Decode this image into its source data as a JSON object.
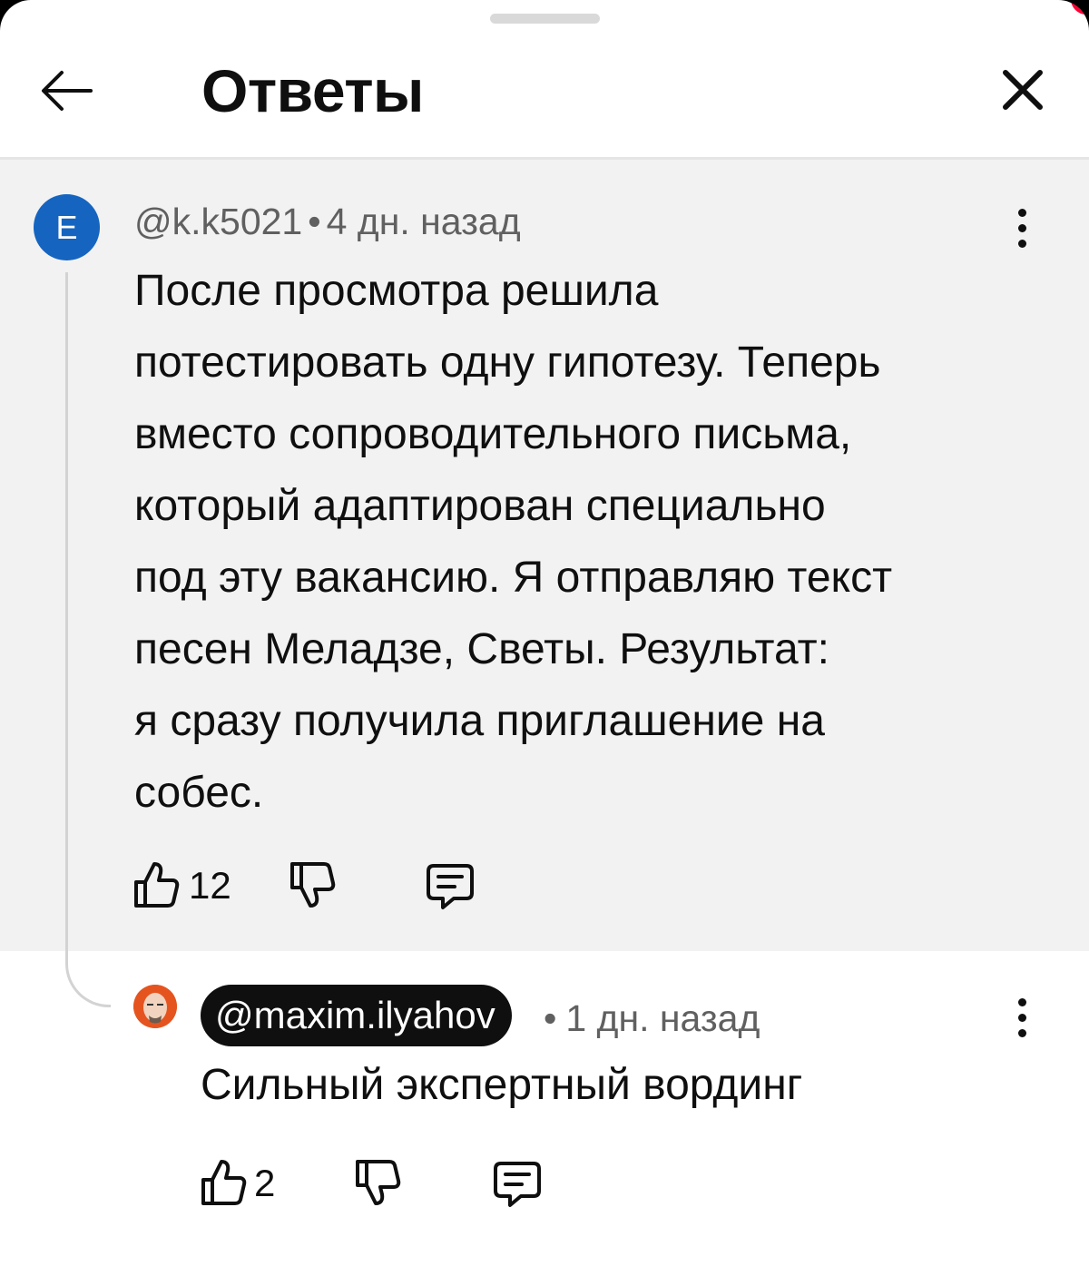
{
  "header": {
    "title": "Ответы",
    "back_icon": "arrow-left-icon",
    "close_icon": "close-icon"
  },
  "comments": [
    {
      "avatar_letter": "E",
      "avatar_color": "#1565c0",
      "author": "@k.k5021",
      "separator": "•",
      "time": "4 дн. назад",
      "text_lines": [
        "После просмотра решила",
        "потестировать одну гипотезу. Теперь",
        "вместо сопроводительного письма,",
        "который адаптирован специально",
        "под эту вакансию. Я отправляю текст",
        "песен Меладзе, Светы. Результат:",
        "я сразу получила приглашение на",
        "собес."
      ],
      "likes": "12"
    }
  ],
  "reply": {
    "author": "@maxim.ilyahov",
    "separator": "•",
    "time": "1 дн. назад",
    "text": "Сильный экспертный вординг",
    "likes": "2"
  },
  "colors": {
    "parent_background": "#f2f2f2",
    "text": "#0f0f0f",
    "meta": "#606060",
    "accent_red": "#ff0033"
  }
}
